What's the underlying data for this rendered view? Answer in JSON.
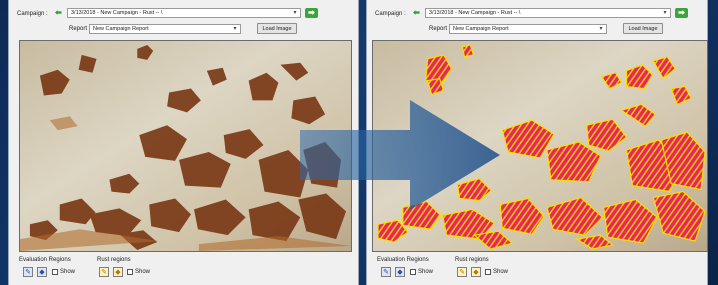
{
  "left_panel": {
    "campaign_label": "Campaign :",
    "campaign_value": "3/13/2018 - New Campaign - Rust -- \\",
    "report_label": "Report",
    "report_value": "New Campaign Report",
    "load_image_label": "Load Image",
    "evaluation_regions_label": "Evaluation Regions",
    "rust_regions_label": "Rust regions",
    "show_label_1": "Show",
    "show_label_2": "Show"
  },
  "right_panel": {
    "campaign_label": "Campaign :",
    "campaign_value": "3/13/2018 - New Campaign - Rust -- \\",
    "report_label": "Report",
    "report_value": "New Campaign Report",
    "load_image_label": "Load Image",
    "evaluation_regions_label": "Evaluation Regions",
    "rust_regions_label": "Rust regions",
    "show_label_1": "Show",
    "show_label_2": "Show"
  },
  "colors": {
    "rust_overlay": "#e8285c",
    "rust_outline": "#f5e000",
    "arrow": "#2d6aa8"
  },
  "icons": [
    "back-arrow-icon",
    "forward-arrow-icon",
    "dropdown-caret-icon",
    "pen-tool-icon",
    "fill-tool-icon",
    "transition-arrow-icon"
  ]
}
